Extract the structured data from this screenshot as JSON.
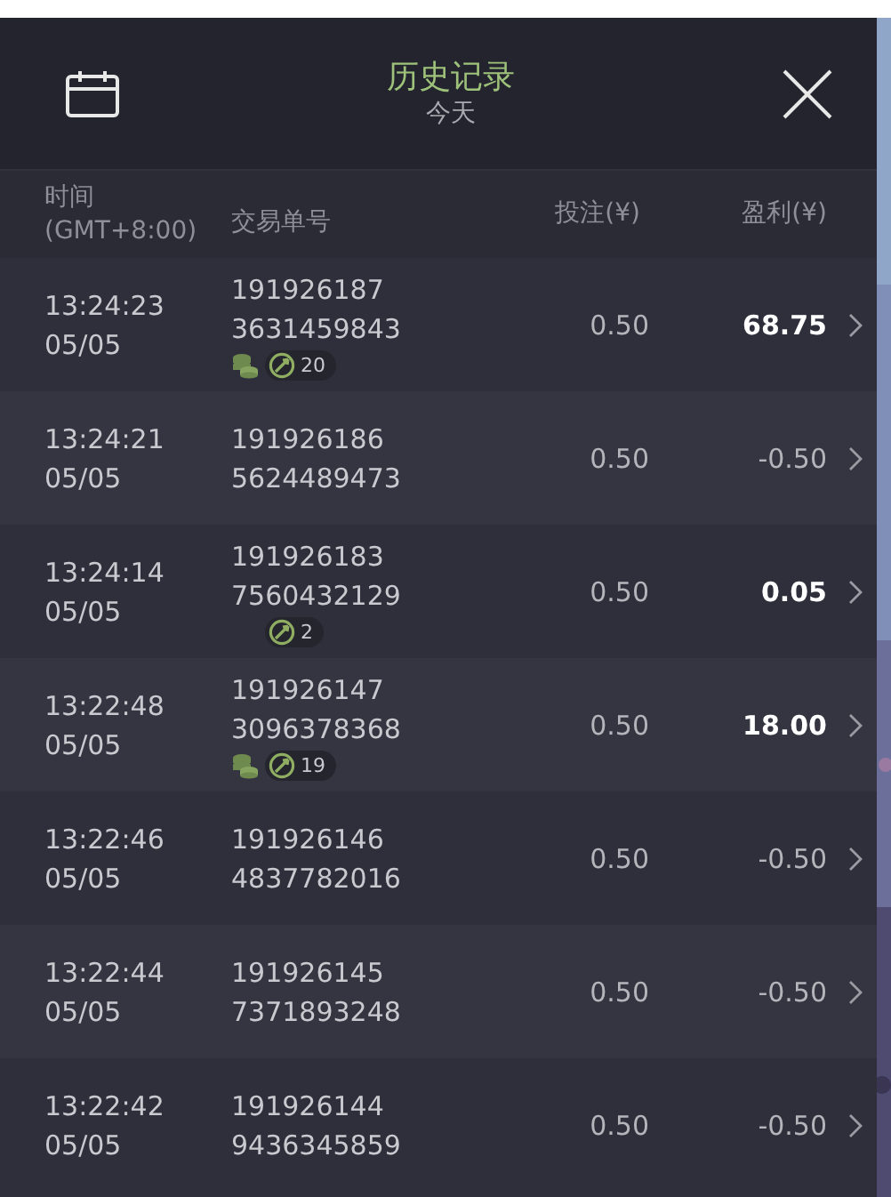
{
  "header": {
    "title": "历史记录",
    "subtitle": "今天"
  },
  "columns": [
    "时间\n(GMT+8:00)",
    "交易单号",
    "投注(¥)",
    "盈利(¥)"
  ],
  "rows": [
    {
      "time": "13:24:23",
      "date": "05/05",
      "id_line_1": "191926187",
      "id_line_2": "3631459843",
      "coins": true,
      "spins": "20",
      "bet": "0.50",
      "profit": "68.75",
      "win": true
    },
    {
      "time": "13:24:21",
      "date": "05/05",
      "id_line_1": "191926186",
      "id_line_2": "5624489473",
      "coins": false,
      "bet": "0.50",
      "profit": "-0.50",
      "win": false
    },
    {
      "time": "13:24:14",
      "date": "05/05",
      "id_line_1": "191926183",
      "id_line_2": "7560432129",
      "coins": false,
      "spins": "2",
      "bet": "0.50",
      "profit": "0.05",
      "win": true
    },
    {
      "time": "13:22:48",
      "date": "05/05",
      "id_line_1": "191926147",
      "id_line_2": "3096378368",
      "coins": true,
      "spins": "19",
      "bet": "0.50",
      "profit": "18.00",
      "win": true
    },
    {
      "time": "13:22:46",
      "date": "05/05",
      "id_line_1": "191926146",
      "id_line_2": "4837782016",
      "coins": false,
      "bet": "0.50",
      "profit": "-0.50",
      "win": false
    },
    {
      "time": "13:22:44",
      "date": "05/05",
      "id_line_1": "191926145",
      "id_line_2": "7371893248",
      "coins": false,
      "bet": "0.50",
      "profit": "-0.50",
      "win": false
    },
    {
      "time": "13:22:42",
      "date": "05/05",
      "id_line_1": "191926144",
      "id_line_2": "9436345859",
      "coins": false,
      "bet": "0.50",
      "profit": "-0.50",
      "win": false
    }
  ]
}
